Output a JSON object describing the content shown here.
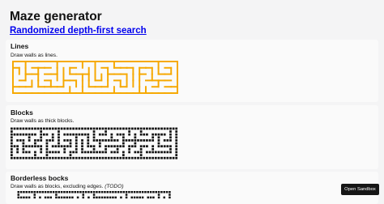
{
  "header": {
    "title": "Maze generator",
    "subtitle_link": "Randomized depth-first search"
  },
  "sections": [
    {
      "heading": "Lines",
      "description": "Draw walls as lines.",
      "maze_style": "lines",
      "maze_color": "#f6a800"
    },
    {
      "heading": "Blocks",
      "description": "Draw walls as thick blocks.",
      "maze_style": "blocks",
      "maze_color": "#111111"
    },
    {
      "heading": "Borderless bocks",
      "description": "Draw walls as blocks, excluding edges.",
      "description_note": "(TODO)",
      "maze_style": "borderless-blocks",
      "maze_color": "#111111"
    }
  ],
  "sandbox_button": {
    "label": "Open Sandbox"
  }
}
